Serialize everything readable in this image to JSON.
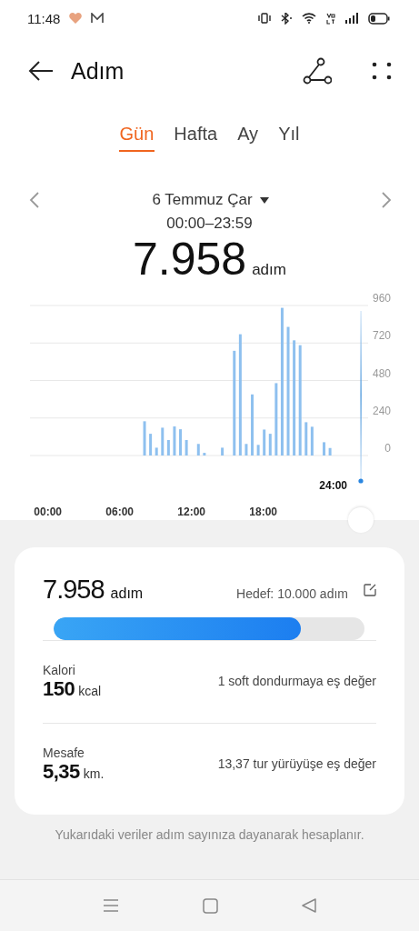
{
  "status_bar": {
    "time": "11:48"
  },
  "header": {
    "title": "Adım"
  },
  "tabs": [
    {
      "label": "Gün",
      "selected": true
    },
    {
      "label": "Hafta",
      "selected": false
    },
    {
      "label": "Ay",
      "selected": false
    },
    {
      "label": "Yıl",
      "selected": false
    }
  ],
  "date_nav": {
    "date": "6 Temmuz Çar",
    "time_range": "00:00–23:59"
  },
  "total": {
    "value": "7.958",
    "unit": "adım"
  },
  "chart": {
    "cursor_label": "24:00",
    "chart_data": {
      "type": "bar",
      "x": [
        8,
        8.5,
        9,
        9.5,
        10,
        10.5,
        11,
        11.5,
        12.5,
        13,
        14.5,
        15.5,
        16,
        16.5,
        17,
        17.5,
        18,
        18.5,
        19,
        19.5,
        20,
        20.5,
        21,
        21.5,
        22,
        23,
        23.5
      ],
      "values": [
        219,
        139,
        50,
        178,
        99,
        186,
        168,
        99,
        74,
        17,
        50,
        670,
        776,
        74,
        391,
        68,
        166,
        139,
        463,
        945,
        823,
        737,
        706,
        213,
        184,
        85,
        48
      ],
      "xlim": [
        0,
        24
      ],
      "ylim": [
        0,
        960
      ],
      "xticks": [
        {
          "value": 0,
          "label": "00:00"
        },
        {
          "value": 6,
          "label": "06:00"
        },
        {
          "value": 12,
          "label": "12:00"
        },
        {
          "value": 18,
          "label": "18:00"
        }
      ],
      "yticks": [
        0,
        240,
        480,
        720,
        960
      ],
      "grid": true
    }
  },
  "summary": {
    "steps": "7.958",
    "unit": "adım",
    "goal": "Hedef: 10.000 adım",
    "level": 0.7958,
    "stats": [
      {
        "label": "Kalori",
        "value": "150",
        "unit": "kcal",
        "note": "1 soft dondurmaya eş değer"
      },
      {
        "label": "Mesafe",
        "value": "5,35",
        "unit": "km.",
        "note": "13,37 tur yürüyüşe eş değer"
      }
    ]
  },
  "footnote": "Yukarıdaki veriler adım sayınıza dayanarak hesaplanır."
}
